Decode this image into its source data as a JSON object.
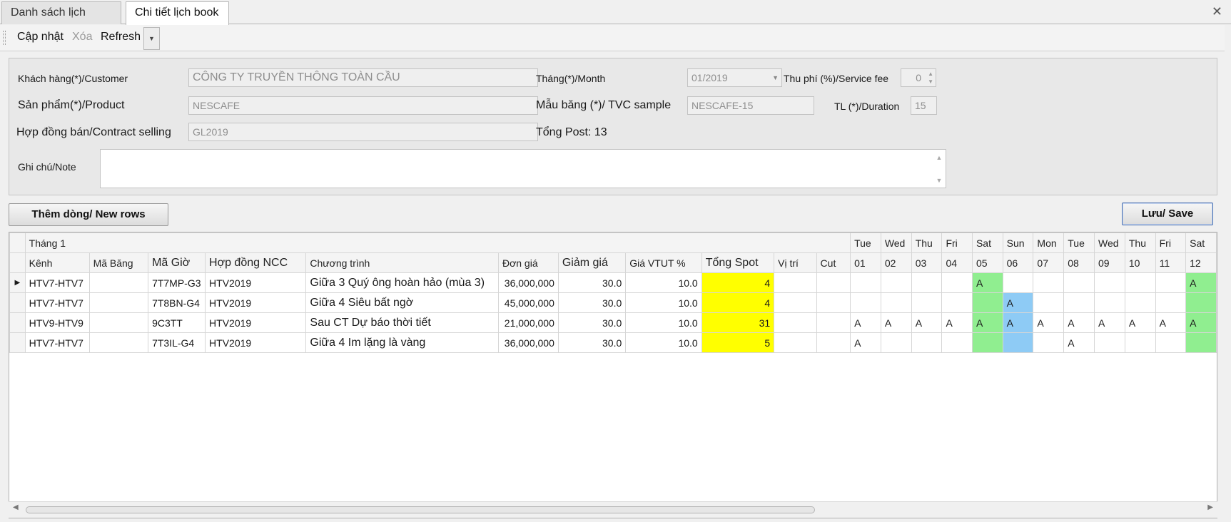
{
  "tabs": [
    {
      "label": "Danh sách lịch book"
    },
    {
      "label": "Chi tiết lịch book"
    }
  ],
  "toolbar": {
    "update_label": "Cập nhật",
    "delete_label": "Xóa",
    "refresh_label": "Refresh"
  },
  "form": {
    "customer_label": "Khách hàng(*)/Customer",
    "customer_value": "CÔNG TY TRUYỀN THÔNG TOÀN CẦU",
    "product_label": "Sản phẩm(*)/Product",
    "product_value": "NESCAFE",
    "contract_label": "Hợp đồng bán/Contract selling",
    "contract_value": "GL2019",
    "note_label": "Ghi chú/Note",
    "month_label": "Tháng(*)/Month",
    "month_value": "01/2019",
    "service_fee_label": "Thu phí (%)/Service fee",
    "service_fee_value": "0",
    "tvc_label": "Mẫu băng (*)/ TVC sample",
    "tvc_value": "NESCAFE-15",
    "duration_label": "TL (*)/Duration",
    "duration_value": "15",
    "total_post": "Tổng Post: 13"
  },
  "buttons": {
    "add_rows": "Thêm dòng/ New rows",
    "save": "Lưu/ Save"
  },
  "grid": {
    "group_header": "Tháng 1",
    "columns": {
      "channel": "Kênh",
      "tape_code": "Mã Băng",
      "time_code": "Mã Giờ",
      "contract_ncc": "Hợp đồng NCC",
      "program": "Chương trình",
      "unit_price": "Đơn giá",
      "discount": "Giảm giá",
      "vtut_price": "Giá VTUT %",
      "total_spot": "Tổng Spot",
      "position": "Vị trí",
      "cut": "Cut"
    },
    "days": [
      {
        "dow": "Tue",
        "day": "01"
      },
      {
        "dow": "Wed",
        "day": "02"
      },
      {
        "dow": "Thu",
        "day": "03"
      },
      {
        "dow": "Fri",
        "day": "04"
      },
      {
        "dow": "Sat",
        "day": "05"
      },
      {
        "dow": "Sun",
        "day": "06"
      },
      {
        "dow": "Mon",
        "day": "07"
      },
      {
        "dow": "Tue",
        "day": "08"
      },
      {
        "dow": "Wed",
        "day": "09"
      },
      {
        "dow": "Thu",
        "day": "10"
      },
      {
        "dow": "Fri",
        "day": "11"
      },
      {
        "dow": "Sat",
        "day": "12"
      }
    ],
    "rows": [
      {
        "channel": "HTV7-HTV7",
        "tape_code": "",
        "time_code": "7T7MP-G3",
        "contract_ncc": "HTV2019",
        "program": "Giữa 3 Quý ông hoàn hảo (mùa 3)",
        "unit_price": "36,000,000",
        "discount": "30.0",
        "vtut_price": "10.0",
        "total_spot": "4",
        "position": "",
        "cut": "",
        "days": [
          "",
          "",
          "",
          "",
          "A",
          "",
          "",
          "",
          "",
          "",
          "",
          "A"
        ]
      },
      {
        "channel": "HTV7-HTV7",
        "tape_code": "",
        "time_code": "7T8BN-G4",
        "contract_ncc": "HTV2019",
        "program": "Giữa 4 Siêu bất ngờ",
        "unit_price": "45,000,000",
        "discount": "30.0",
        "vtut_price": "10.0",
        "total_spot": "4",
        "position": "",
        "cut": "",
        "days": [
          "",
          "",
          "",
          "",
          "",
          "A",
          "",
          "",
          "",
          "",
          "",
          ""
        ]
      },
      {
        "channel": "HTV9-HTV9",
        "tape_code": "",
        "time_code": "9C3TT",
        "contract_ncc": "HTV2019",
        "program": "Sau CT Dự báo thời tiết",
        "unit_price": "21,000,000",
        "discount": "30.0",
        "vtut_price": "10.0",
        "total_spot": "31",
        "position": "",
        "cut": "",
        "days": [
          "A",
          "A",
          "A",
          "A",
          "A",
          "A",
          "A",
          "A",
          "A",
          "A",
          "A",
          "A"
        ]
      },
      {
        "channel": "HTV7-HTV7",
        "tape_code": "",
        "time_code": "7T3IL-G4",
        "contract_ncc": "HTV2019",
        "program": "Giữa 4 Im lặng là vàng",
        "unit_price": "36,000,000",
        "discount": "30.0",
        "vtut_price": "10.0",
        "total_spot": "5",
        "position": "",
        "cut": "",
        "days": [
          "A",
          "",
          "",
          "",
          "",
          "",
          "",
          "A",
          "",
          "",
          "",
          ""
        ]
      }
    ],
    "highlight": {
      "spot_color": "#ffff00",
      "weekend_color": "#90ee90",
      "booked_sun_color": "#8ecbf5"
    }
  }
}
